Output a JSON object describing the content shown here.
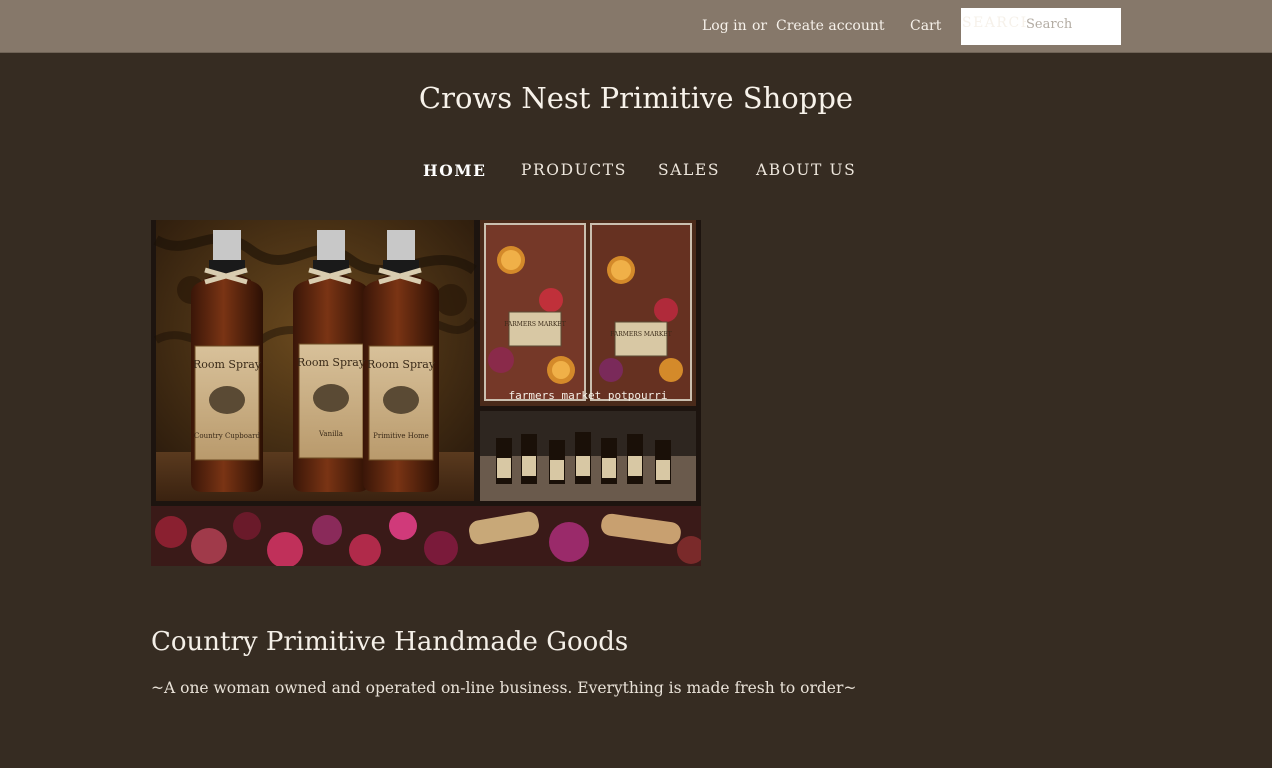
{
  "header": {
    "login_label": "Log in",
    "or_label": "or",
    "create_account_label": "Create account",
    "cart_label": "Cart",
    "search_label": "SEARCH",
    "search_placeholder": "Search"
  },
  "site_title": "Crows Nest Primitive Shoppe",
  "nav": [
    {
      "label": "HOME",
      "active": true
    },
    {
      "label": "PRODUCTS",
      "active": false
    },
    {
      "label": "SALES",
      "active": false
    },
    {
      "label": "ABOUT US",
      "active": false
    }
  ],
  "hero": {
    "bottle_labels": [
      "Room Spray",
      "Room Spray",
      "Room Spray"
    ],
    "bottle_scents": [
      "Country Cupboard",
      "Vanilla",
      "Primitive Home"
    ],
    "potpourri_caption": "farmers market potpourri",
    "bag_label": "FARMERS MARKET"
  },
  "main": {
    "heading": "Country Primitive Handmade Goods",
    "tagline": "~A one woman owned and operated on-line business. Everything is made fresh to order~"
  },
  "colors": {
    "background": "#362c22",
    "topbar": "#86786a",
    "text": "#f2ede4"
  }
}
